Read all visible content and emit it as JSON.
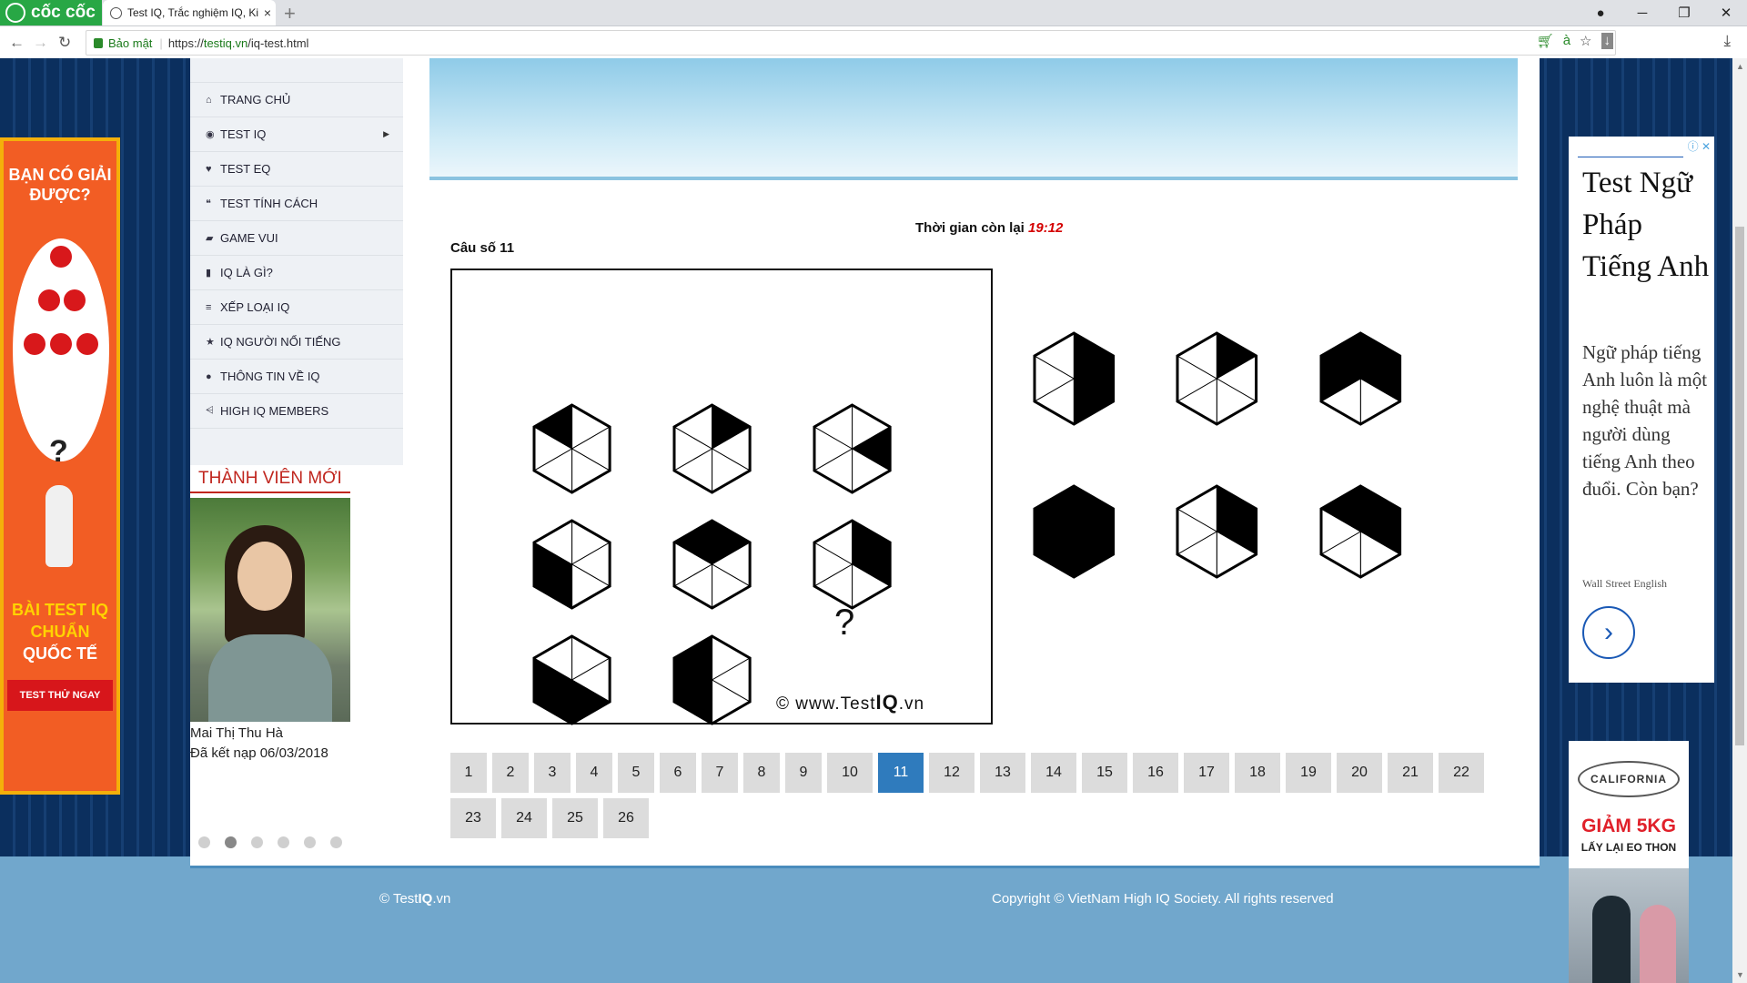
{
  "browser": {
    "brand": "cốc cốc",
    "tab_title": "Test IQ, Trắc nghiệm IQ, Ki",
    "new_tab": "+",
    "url_secure_label": "Bảo mật",
    "url_prefix": "https://",
    "url_host": "testiq.vn",
    "url_path": "/iq-test.html"
  },
  "sidebar": {
    "items": [
      {
        "label": "TRANG CHỦ",
        "icon": "home-icon",
        "glyph": "⌂"
      },
      {
        "label": "TEST IQ",
        "icon": "brain-icon",
        "glyph": "◉",
        "has_submenu": true
      },
      {
        "label": "TEST EQ",
        "icon": "heart-icon",
        "glyph": "♥"
      },
      {
        "label": "TEST TÍNH CÁCH",
        "icon": "chat-icon",
        "glyph": "❝"
      },
      {
        "label": "GAME VUI",
        "icon": "gamepad-icon",
        "glyph": "▰"
      },
      {
        "label": "IQ LÀ GÌ?",
        "icon": "book-icon",
        "glyph": "▮"
      },
      {
        "label": "XẾP LOẠI IQ",
        "icon": "list-icon",
        "glyph": "≡"
      },
      {
        "label": "IQ NGƯỜI NỔI TIẾNG",
        "icon": "star-icon",
        "glyph": "★"
      },
      {
        "label": "THÔNG TIN VỀ IQ",
        "icon": "info-icon",
        "glyph": "●"
      },
      {
        "label": "HIGH IQ MEMBERS",
        "icon": "users-icon",
        "glyph": "⩤"
      }
    ],
    "new_members_title": "THÀNH VIÊN MỚI",
    "member_name": "Mai Thị Thu Hà",
    "member_joined": "Đã kết nạp 06/03/2018",
    "carousel_active_index": 1
  },
  "quiz": {
    "timer_label": "Thời gian còn lại",
    "timer_value": "19:12",
    "question_label": "Câu số 11",
    "missing_mark": "?",
    "watermark_prefix": "© www.Test",
    "watermark_bold": "IQ",
    "watermark_suffix": ".vn",
    "puzzle_cells": [
      {
        "black": [
          5
        ]
      },
      {
        "black": [
          0
        ]
      },
      {
        "black": [
          1
        ]
      },
      {
        "black": [
          3,
          4
        ]
      },
      {
        "black": [
          5,
          0
        ]
      },
      {
        "black": [
          0,
          1
        ]
      },
      {
        "black": [
          3,
          4,
          2
        ]
      },
      {
        "black": [
          4,
          5,
          3
        ]
      }
    ],
    "answers": [
      {
        "black": [
          0,
          1,
          2
        ]
      },
      {
        "black": [
          0
        ]
      },
      {
        "black": [
          4,
          5,
          0,
          1
        ]
      },
      {
        "black": [
          0,
          1,
          2,
          3,
          4,
          5
        ]
      },
      {
        "black": [
          0,
          1
        ]
      },
      {
        "black": [
          0,
          1,
          5
        ]
      }
    ]
  },
  "pager": {
    "pages": [
      "1",
      "2",
      "3",
      "4",
      "5",
      "6",
      "7",
      "8",
      "9",
      "10",
      "11",
      "12",
      "13",
      "14",
      "15",
      "16",
      "17",
      "18",
      "19",
      "20",
      "21",
      "22",
      "23",
      "24",
      "25",
      "26"
    ],
    "active": "11"
  },
  "footer": {
    "left_prefix": "© Test",
    "left_bold": "IQ",
    "left_suffix": ".vn",
    "right": "Copyright © VietNam High IQ Society. All rights reserved"
  },
  "ads": {
    "left_top": "BẠN CÓ GIẢI ĐƯỢC?",
    "left_q": "?",
    "left_line1": "BÀI TEST IQ",
    "left_line2": "CHUẨN",
    "left_line3": "QUỐC TẾ",
    "left_cta": "TEST THỬ NGAY",
    "right_heading": "Test Ngữ Pháp Tiếng Anh",
    "right_body": "Ngữ pháp tiếng Anh luôn là một nghệ thuật mà người dùng tiếng Anh theo đuổi. Còn bạn?",
    "right_source": "Wall Street English",
    "right2_logo": "CALIFORNIA",
    "right2_offer": "GIẢM 5KG",
    "right2_sub": "LẤY LẠI EO THON"
  }
}
